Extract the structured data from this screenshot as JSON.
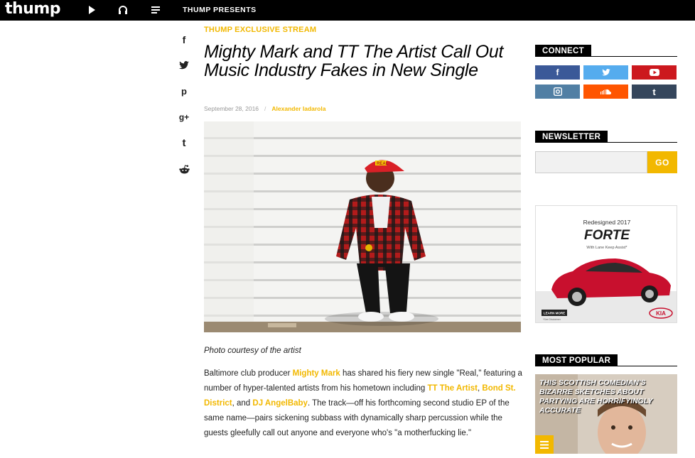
{
  "nav": {
    "logo": "thump",
    "presents": "THUMP PRESENTS"
  },
  "share": {
    "facebook": "f",
    "twitter": "t",
    "pinterest": "p",
    "googleplus": "g+",
    "tumblr": "t",
    "reddit": "r"
  },
  "article": {
    "kicker": "THUMP EXCLUSIVE STREAM",
    "headline": "Mighty Mark and TT The Artist Call Out Music Industry Fakes in New Single",
    "date": "September 28, 2016",
    "separator": "/",
    "author": "Alexander Iadarola",
    "photo_caption": "Photo courtesy of the artist",
    "hat_text": "REAL",
    "body": {
      "p1": "Baltimore club producer ",
      "link1": "Mighty Mark",
      "p2": " has shared his fiery new single \"Real,\" featuring a number of hyper-talented artists from his hometown including ",
      "link2": "TT The Artist",
      "p3": ", ",
      "link3": "Bond St. District",
      "p4": ", and ",
      "link4": "DJ AngelBaby",
      "p5": ". The track—off his forthcoming second studio EP of the same name—pairs sickening subbass with dynamically sharp percussion while the guests gleefully call out anyone and everyone who's \"a motherfucking lie.\""
    }
  },
  "sidebar": {
    "connect": "CONNECT",
    "newsletter": "NEWSLETTER",
    "newsletter_placeholder": "",
    "go": "GO",
    "most_popular": "MOST POPULAR",
    "popular_title": "THIS SCOTTISH COMEDIAN'S BIZARRE SKETCHES ABOUT PARTYING ARE HORRIFYINGLY ACCURATE"
  },
  "ad": {
    "tagline": "Redesigned 2017",
    "model": "FORTE",
    "feature": "With Lane Keep Assist*",
    "cta": "LEARN MORE",
    "brand": "KIA",
    "disclaimer": "*See Disclaimer"
  },
  "colors": {
    "accent": "#f2b800",
    "facebook": "#3b5998",
    "twitter": "#55acee",
    "youtube": "#cc181e",
    "instagram": "#517fa4",
    "soundcloud": "#ff5500",
    "tumblr": "#35465c"
  }
}
